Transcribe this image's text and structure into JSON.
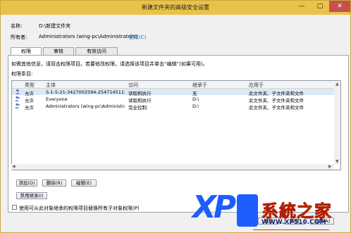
{
  "window": {
    "title": "新建文件夹的高级安全设置",
    "min_label": "—",
    "max_label": "□",
    "close_label": "✕"
  },
  "info": {
    "name_label": "名称:",
    "name_value": "D:\\新建文件夹",
    "owner_label": "所有者:",
    "owner_value": "Administrators (wing-pc\\Administrators)",
    "change_link": "更改(C)"
  },
  "tabs": [
    {
      "label": "权限"
    },
    {
      "label": "审核"
    },
    {
      "label": "有效访问"
    }
  ],
  "panel": {
    "hint": "如需其他信息，请双击权限项目。若要修改权限，请选择该项目并单击“编辑”(如果可用)。",
    "entries_label": "权限条目:",
    "columns": [
      "类型",
      "主体",
      "访问",
      "继承于",
      "应用于"
    ],
    "rows": [
      [
        "允许",
        "S-1-5-21-3427002594-2547145112-3...",
        "读取和执行",
        "无",
        "此文件夹、子文件夹和文件"
      ],
      [
        "允许",
        "Everyone",
        "读取和执行",
        "D:\\",
        "此文件夹、子文件夹和文件"
      ],
      [
        "允许",
        "Administrators (wing-pc\\Administrat...",
        "完全控制",
        "D:\\",
        "此文件夹、子文件夹和文件"
      ]
    ],
    "add_label": "添加(D)",
    "remove_label": "删除(R)",
    "edit_label": "编辑(E)",
    "disable_inherit_label": "禁用继承(I)",
    "replace_label": "使用可从此对象继承的权限项目替换所有子对象权限(P)"
  },
  "footer": {
    "ok_label": "确定",
    "cancel_label": "取消",
    "apply_label": "应用(A)"
  },
  "watermark": {
    "logo_text": "XP",
    "cn_text": "系統之家",
    "url_text": "WWW.XP510.COM"
  }
}
